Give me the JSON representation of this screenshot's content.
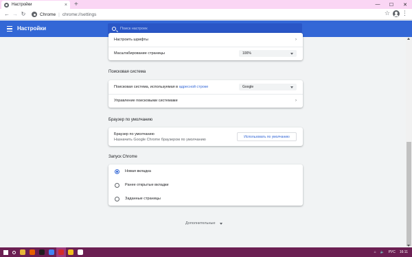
{
  "browser": {
    "tab_title": "Настройки",
    "new_tab_symbol": "+",
    "tab_close_symbol": "×",
    "window_controls": [
      "—",
      "☐",
      "✕"
    ],
    "nav": {
      "back": "←",
      "forward": "→",
      "reload": "↻"
    },
    "omnibox": {
      "scheme_label": "Chrome",
      "separator": "|",
      "url": "chrome://settings"
    },
    "star_symbol": "☆",
    "menu_symbol": "⋮"
  },
  "header": {
    "title": "Настройки",
    "search_placeholder": "Поиск настроек"
  },
  "appearance": {
    "fonts_label": "Настроить шрифты",
    "zoom_label": "Масштабирование страницы",
    "zoom_value": "100%"
  },
  "search_engine": {
    "section_title": "Поисковая система",
    "engine_label_prefix": "Поисковая система, используемая в ",
    "engine_label_link": "адресной строке",
    "engine_value": "Google",
    "manage_label": "Управление поисковыми системами"
  },
  "default_browser": {
    "section_title": "Браузер по умолчанию",
    "label": "Браузер по умолчанию",
    "sublabel": "Назначить Google Chrome браузером по умолчанию",
    "button": "Использовать по умолчанию"
  },
  "startup": {
    "section_title": "Запуск Chrome",
    "options": [
      {
        "label": "Новая вкладка",
        "checked": true
      },
      {
        "label": "Ранее открытые вкладки",
        "checked": false
      },
      {
        "label": "Заданные страницы",
        "checked": false
      }
    ]
  },
  "advanced_label": "Дополнительные",
  "taskbar": {
    "apps": [
      {
        "name": "firefox",
        "color": "#e66000"
      },
      {
        "name": "media-player",
        "color": "#1e1e1e"
      },
      {
        "name": "chrome",
        "color": "#4285f4"
      },
      {
        "name": "app-red",
        "color": "#d22b2b"
      },
      {
        "name": "paint",
        "color": "#f0c020"
      },
      {
        "name": "settings",
        "color": "#ffffff"
      }
    ],
    "tray": {
      "language": "РУС",
      "time": "16:11",
      "volume": "🔈",
      "network": "⌂"
    }
  },
  "colors": {
    "header_blue": "#3367d6",
    "link_blue": "#3367d6",
    "background": "#f1f3f4",
    "tabstrip": "#fad6f4",
    "taskbar": "#6b1f52"
  }
}
